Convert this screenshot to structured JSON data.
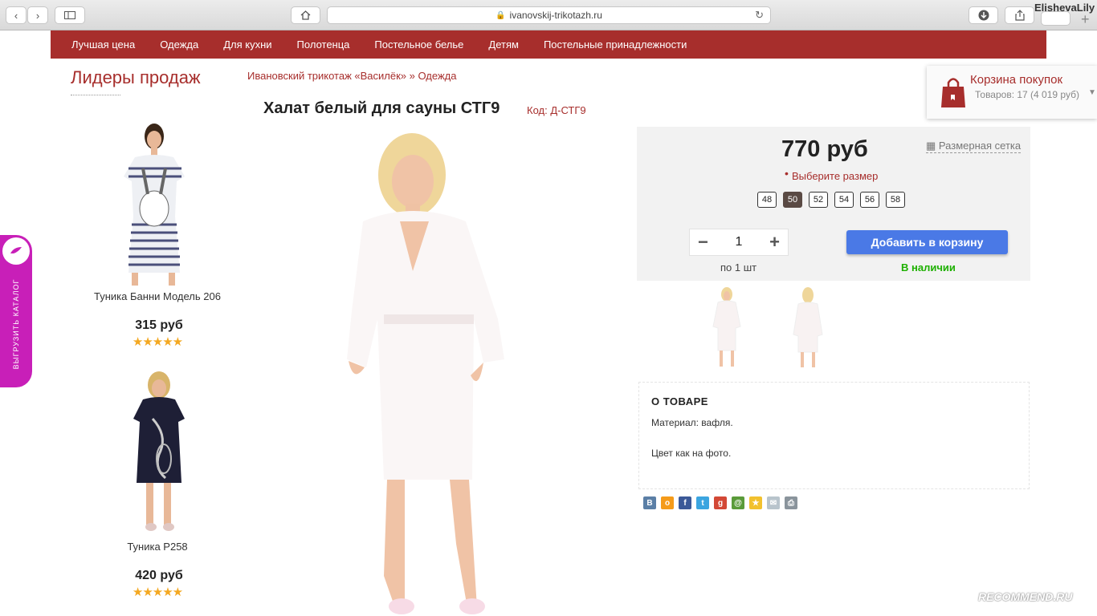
{
  "browser": {
    "url": "ivanovskij-trikotazh.ru",
    "user": "ElishevaLily"
  },
  "nav": [
    "Лучшая цена",
    "Одежда",
    "Для кухни",
    "Полотенца",
    "Постельное белье",
    "Детям",
    "Постельные принадлежности"
  ],
  "sidebar": {
    "title": "Лидеры продаж",
    "products": [
      {
        "name": "Туника Банни Модель 206",
        "price": "315 руб",
        "rating": 5
      },
      {
        "name": "Туника Р258",
        "price": "420 руб",
        "rating": 5
      }
    ]
  },
  "side_tab": {
    "label": "ВЫГРУЗИТЬ КАТАЛОГ"
  },
  "breadcrumb": "Ивановский трикотаж «Василёк» » Одежда",
  "product": {
    "title": "Халат белый для сауны СТГ9",
    "code": "Код: Д-СТГ9",
    "price": "770 руб",
    "size_chart": "Размерная сетка",
    "choose_size": "Выберите размер",
    "sizes": [
      "48",
      "50",
      "52",
      "54",
      "56",
      "58"
    ],
    "selected_size": "50",
    "quantity": "1",
    "per_unit": "по 1 шт",
    "add_to_cart": "Добавить в корзину",
    "stock": "В наличии",
    "about_title": "О ТОВАРЕ",
    "material": "Материал: вафля.",
    "color": "Цвет как на фото."
  },
  "cart": {
    "title": "Корзина покупок",
    "summary": "Товаров: 17 (4 019 руб)"
  },
  "colors": {
    "brand": "#a72e2c",
    "button": "#4a79e6",
    "in_stock": "#1db000",
    "side_tab": "#c81fb8",
    "star": "#f4a821"
  },
  "watermark": "RECOMMEND.RU"
}
